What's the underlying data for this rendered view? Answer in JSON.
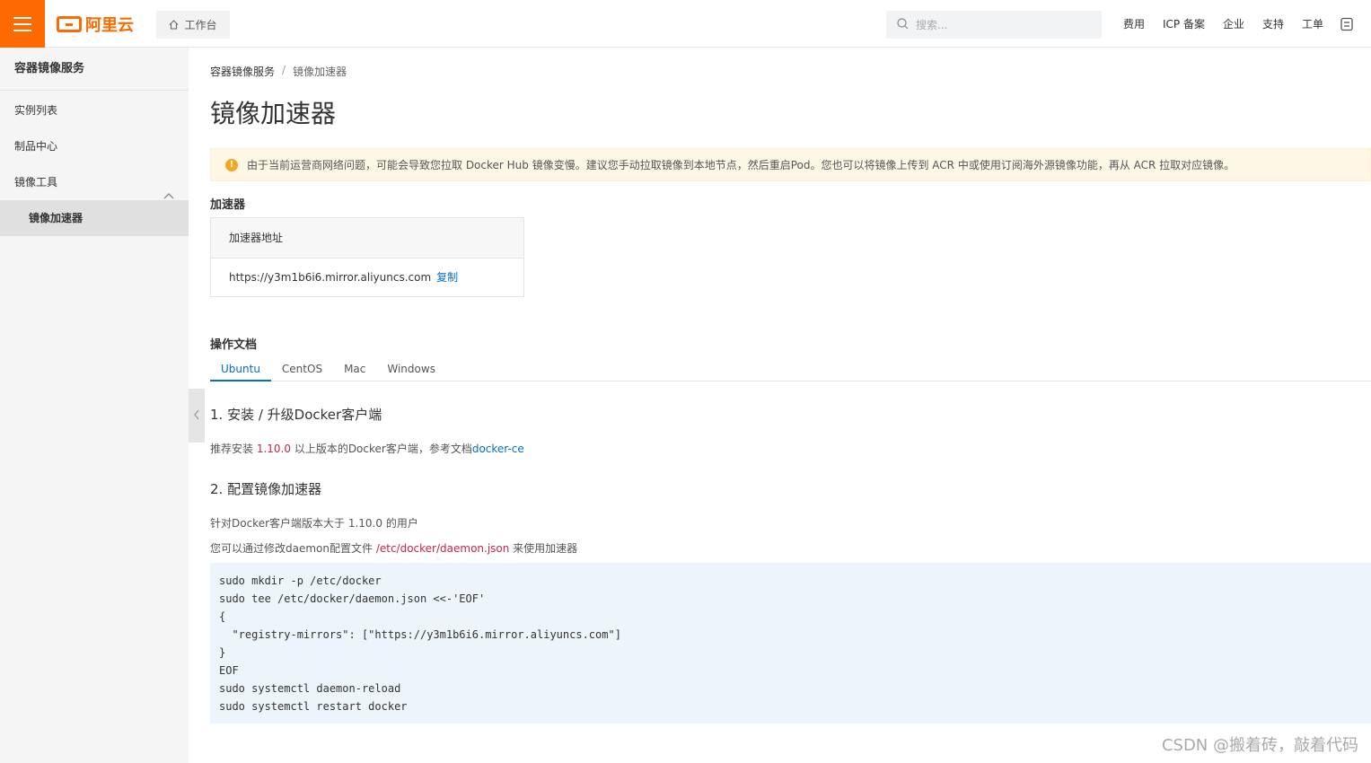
{
  "header": {
    "logo_text": "阿里云",
    "workbench_label": "工作台",
    "search_placeholder": "搜索...",
    "nav": [
      "费用",
      "ICP 备案",
      "企业",
      "支持",
      "工单"
    ]
  },
  "sidebar": {
    "title": "容器镜像服务",
    "items": [
      {
        "label": "实例列表"
      },
      {
        "label": "制品中心"
      },
      {
        "label": "镜像工具"
      },
      {
        "label": "镜像加速器"
      }
    ]
  },
  "breadcrumb": {
    "parent": "容器镜像服务",
    "separator": "/",
    "current": "镜像加速器"
  },
  "page_title": "镜像加速器",
  "alert": {
    "text": "由于当前运营商网络问题，可能会导致您拉取 Docker Hub 镜像变慢。建议您手动拉取镜像到本地节点，然后重启Pod。您也可以将镜像上传到 ACR 中或使用订阅海外源镜像功能，再从 ACR 拉取对应镜像。"
  },
  "accelerator": {
    "section_title": "加速器",
    "header": "加速器地址",
    "url": "https://y3m1b6i6.mirror.aliyuncs.com",
    "copy_label": "复制"
  },
  "docs": {
    "section_title": "操作文档",
    "tabs": [
      "Ubuntu",
      "CentOS",
      "Mac",
      "Windows"
    ],
    "step1_title": "1. 安装 / 升级Docker客户端",
    "step1_pre": "推荐安装 ",
    "step1_version": "1.10.0",
    "step1_mid": " 以上版本的Docker客户端，参考文档",
    "step1_link": "docker-ce",
    "step2_title": "2. 配置镜像加速器",
    "step2_line1": "针对Docker客户端版本大于 1.10.0 的用户",
    "step2_line2_pre": "您可以通过修改daemon配置文件 ",
    "step2_line2_path": "/etc/docker/daemon.json",
    "step2_line2_post": " 来使用加速器",
    "code_lines": [
      "sudo mkdir -p /etc/docker",
      "sudo tee /etc/docker/daemon.json <<-'EOF'",
      "{",
      "  \"registry-mirrors\": [\"https://y3m1b6i6.mirror.aliyuncs.com\"]",
      "}",
      "EOF",
      "sudo systemctl daemon-reload",
      "sudo systemctl restart docker"
    ]
  },
  "watermark": "CSDN @搬着砖，敲着代码",
  "colors": {
    "brand": "#ff6a00",
    "link": "#0070cc",
    "alert_bg": "#fff7e6",
    "code_bg": "#eef4fb"
  }
}
